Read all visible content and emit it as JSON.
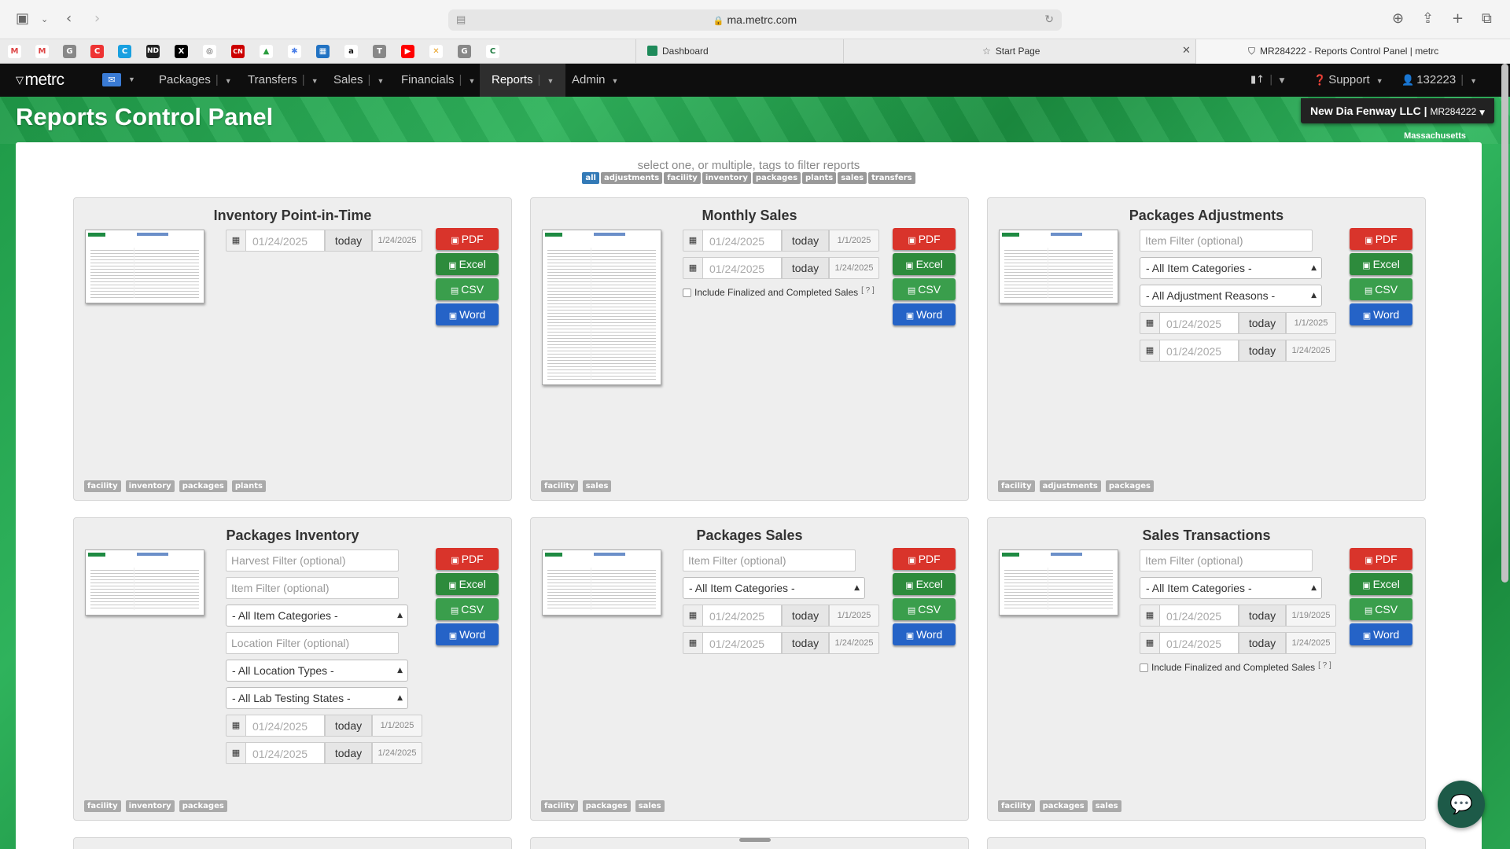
{
  "browser": {
    "url": "ma.metrc.com",
    "tabs": [
      {
        "label": "Dashboard"
      },
      {
        "label": "Start Page"
      },
      {
        "label": "MR284222 - Reports Control Panel | metrc"
      }
    ]
  },
  "nav": {
    "logo": "metrc",
    "items": [
      "Packages",
      "Transfers",
      "Sales",
      "Financials",
      "Reports",
      "Admin"
    ],
    "support": "Support",
    "user": "132223"
  },
  "header": {
    "title": "Reports Control Panel",
    "facility_name": "New Dia Fenway LLC",
    "facility_license": "MR284222",
    "state": "Massachusetts"
  },
  "filter": {
    "hint": "select one, or multiple, tags to filter reports",
    "tags": [
      "all",
      "adjustments",
      "facility",
      "inventory",
      "packages",
      "plants",
      "sales",
      "transfers"
    ]
  },
  "common": {
    "today": "today",
    "date_value": "01/24/2025",
    "pdf": "PDF",
    "excel": "Excel",
    "csv": "CSV",
    "word": "Word",
    "include_finalized": "Include Finalized and Completed Sales",
    "help": "[ ? ]",
    "item_filter": "Item Filter (optional)",
    "harvest_filter": "Harvest Filter (optional)",
    "location_filter": "Location Filter (optional)",
    "all_item_categories": "- All Item Categories -",
    "all_adjustment_reasons": "- All Adjustment Reasons -",
    "all_location_types": "- All Location Types -",
    "all_lab_testing_states": "- All Lab Testing States -"
  },
  "reports": {
    "inventory_pit": {
      "title": "Inventory Point-in-Time",
      "date1_default": "1/24/2025",
      "tags": [
        "facility",
        "inventory",
        "packages",
        "plants"
      ]
    },
    "monthly_sales": {
      "title": "Monthly Sales",
      "date1_default": "1/1/2025",
      "date2_default": "1/24/2025",
      "tags": [
        "facility",
        "sales"
      ]
    },
    "packages_adjustments": {
      "title": "Packages Adjustments",
      "date1_default": "1/1/2025",
      "date2_default": "1/24/2025",
      "tags": [
        "facility",
        "adjustments",
        "packages"
      ]
    },
    "packages_inventory": {
      "title": "Packages Inventory",
      "date1_default": "1/1/2025",
      "date2_default": "1/24/2025",
      "tags": [
        "facility",
        "inventory",
        "packages"
      ]
    },
    "packages_sales": {
      "title": "Packages Sales",
      "date1_default": "1/1/2025",
      "date2_default": "1/24/2025",
      "tags": [
        "facility",
        "packages",
        "sales"
      ]
    },
    "sales_transactions": {
      "title": "Sales Transactions",
      "date1_default": "1/19/2025",
      "date2_default": "1/24/2025",
      "tags": [
        "facility",
        "packages",
        "sales"
      ]
    }
  },
  "colors": {
    "brand_green": "#2fb35c",
    "pdf": "#d9342b",
    "excel": "#2d8b3c",
    "word": "#2563c7",
    "tag_active": "#337ab7"
  }
}
